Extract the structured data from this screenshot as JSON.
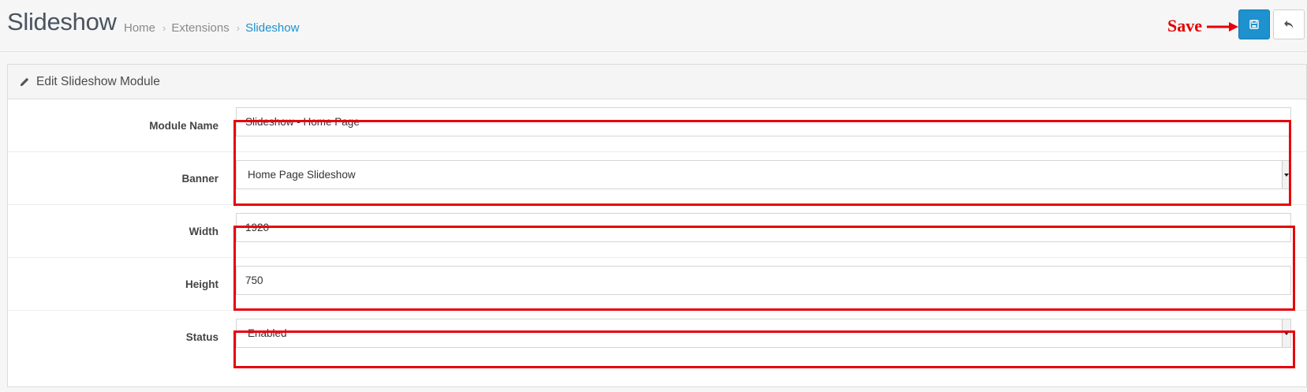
{
  "header": {
    "title": "Slideshow",
    "breadcrumb": [
      "Home",
      "Extensions",
      "Slideshow"
    ],
    "sep": "›"
  },
  "annotation": {
    "save_label": "Save",
    "color": "#e8000b"
  },
  "toolbar": {
    "save_icon": "floppy-disk-icon",
    "back_icon": "reply-icon",
    "save_color": "#1e91cf"
  },
  "panel": {
    "title": "Edit Slideshow Module",
    "title_icon": "pencil-icon"
  },
  "form": {
    "module_name": {
      "label": "Module Name",
      "value": "Slideshow - Home Page"
    },
    "banner": {
      "label": "Banner",
      "value": "Home Page Slideshow"
    },
    "width": {
      "label": "Width",
      "value": "1920"
    },
    "height": {
      "label": "Height",
      "value": "750"
    },
    "status": {
      "label": "Status",
      "value": "Enabled"
    }
  }
}
